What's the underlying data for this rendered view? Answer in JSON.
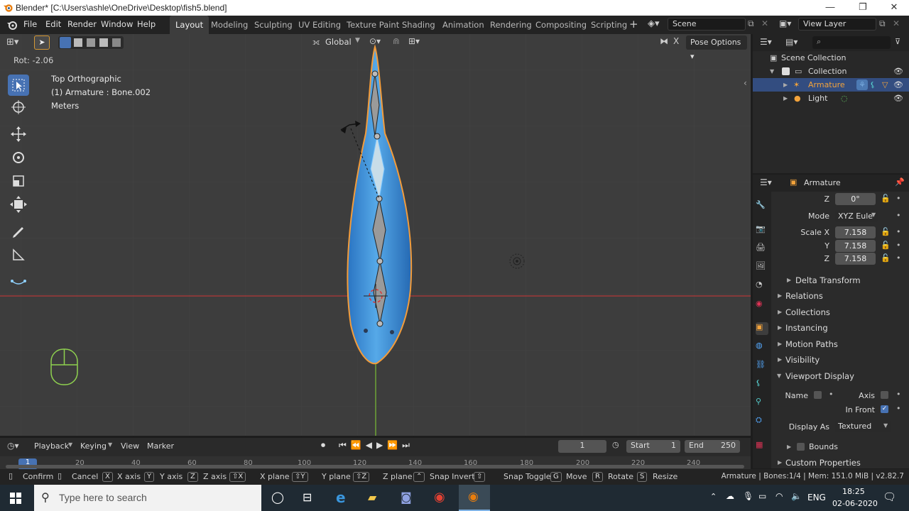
{
  "window": {
    "title": "Blender* [C:\\Users\\ashle\\OneDrive\\Desktop\\fish5.blend]",
    "controls": [
      "—",
      "❐",
      "✕"
    ]
  },
  "menus": [
    "File",
    "Edit",
    "Render",
    "Window",
    "Help"
  ],
  "workspaces": [
    "Layout",
    "Modeling",
    "Sculpting",
    "UV Editing",
    "Texture Paint",
    "Shading",
    "Animation",
    "Rendering",
    "Compositing",
    "Scripting"
  ],
  "active_workspace": "Layout",
  "scene": {
    "label": "Scene",
    "view_layer": "View Layer"
  },
  "viewport_header": {
    "orientation": "Global",
    "pose_options": "Pose Options"
  },
  "viewport": {
    "rotation_readout": "Rot: -2.06",
    "view_name": "Top Orthographic",
    "context": "(1) Armature : Bone.002",
    "units": "Meters"
  },
  "outliner": {
    "items": [
      {
        "label": "Scene Collection",
        "type": "root"
      },
      {
        "label": "Collection",
        "type": "collection"
      },
      {
        "label": "Armature",
        "type": "armature",
        "selected": true
      },
      {
        "label": "Light",
        "type": "light"
      }
    ]
  },
  "properties": {
    "object_name": "Armature",
    "rotation_z": {
      "label": "Z",
      "value": "0°"
    },
    "mode": {
      "label": "Mode",
      "value": "XYZ Eule"
    },
    "scale": [
      {
        "label": "Scale X",
        "value": "7.158"
      },
      {
        "label": "Y",
        "value": "7.158"
      },
      {
        "label": "Z",
        "value": "7.158"
      }
    ],
    "panels": [
      "Delta Transform",
      "Relations",
      "Collections",
      "Instancing",
      "Motion Paths",
      "Visibility",
      "Viewport Display"
    ],
    "viewport_display": {
      "name_label": "Name",
      "axis_label": "Axis",
      "in_front_label": "In Front",
      "display_as_label": "Display As",
      "display_as_value": "Textured",
      "bounds_label": "Bounds",
      "custom_properties": "Custom Properties"
    }
  },
  "timeline": {
    "menus": [
      "Playback",
      "Keying",
      "View",
      "Marker"
    ],
    "current_frame": "1",
    "start_label": "Start",
    "start": "1",
    "end_label": "End",
    "end": "250",
    "ruler": [
      "1",
      "20",
      "40",
      "60",
      "80",
      "100",
      "120",
      "140",
      "160",
      "180",
      "200",
      "220",
      "240"
    ]
  },
  "status": {
    "hints": [
      {
        "key": "",
        "label": "Confirm"
      },
      {
        "key": "",
        "label": "Cancel"
      },
      {
        "key": "X",
        "label": "X axis"
      },
      {
        "key": "Y",
        "label": "Y axis"
      },
      {
        "key": "Z",
        "label": "Z axis"
      },
      {
        "key": "⇧X",
        "label": "X plane"
      },
      {
        "key": "⇧Y",
        "label": "Y plane"
      },
      {
        "key": "⇧Z",
        "label": "Z plane"
      },
      {
        "key": "",
        "label": "Snap Invert"
      },
      {
        "key": "⇧",
        "label": "Snap Toggle"
      },
      {
        "key": "G",
        "label": "Move"
      },
      {
        "key": "R",
        "label": "Rotate"
      },
      {
        "key": "S",
        "label": "Resize"
      }
    ],
    "stats": "Armature | Bones:1/4 | Mem: 151.0 MiB | v2.82.7"
  },
  "taskbar": {
    "search_placeholder": "Type here to search",
    "language": "ENG",
    "time": "18:25",
    "date": "02-06-2020"
  },
  "colors": {
    "accent_blue": "#4772b3",
    "selected_orange": "#f3a33b",
    "fish_blue": "#3b8fd4",
    "x_axis_red": "#b03a3a",
    "y_axis_green": "#6ea336"
  }
}
